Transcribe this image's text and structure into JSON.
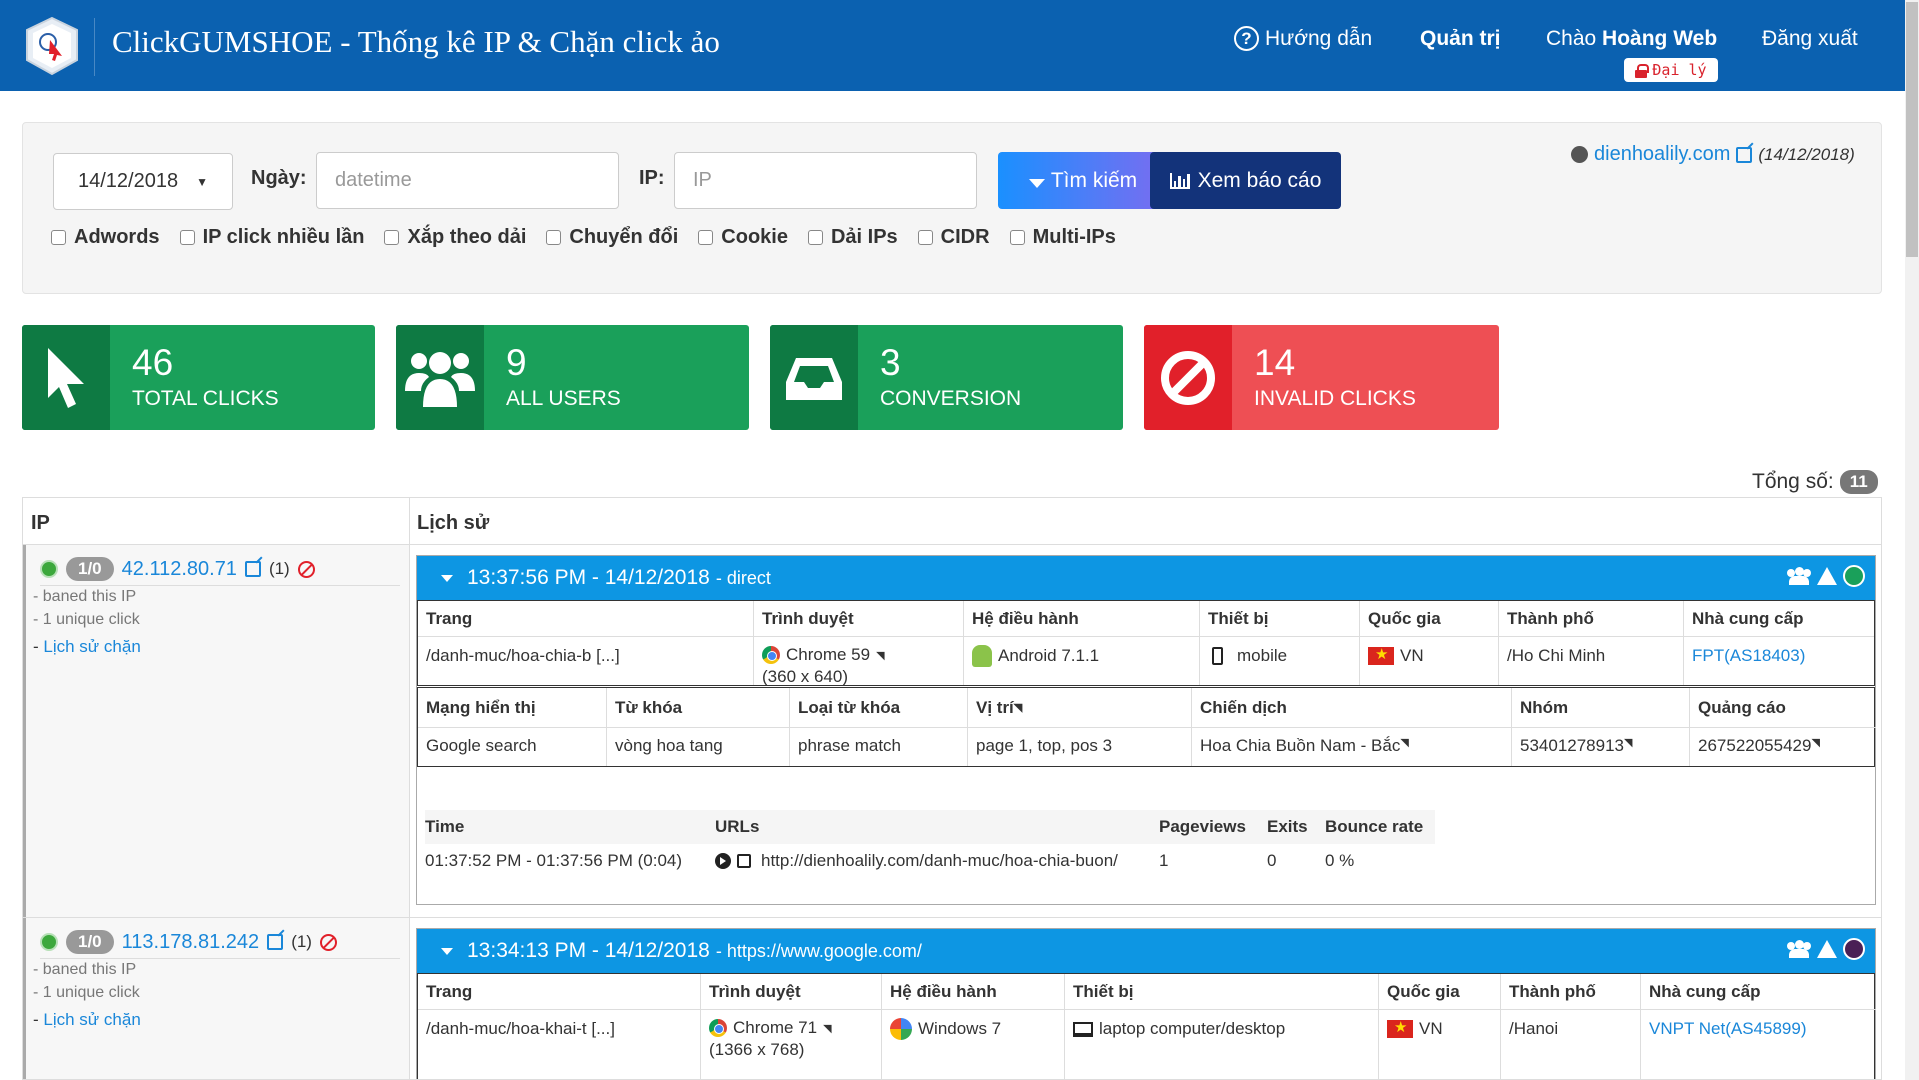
{
  "header": {
    "title": "ClickGUMSHOE - Thống kê IP & Chặn click ảo",
    "nav_help": "Hướng dẫn",
    "nav_admin": "Quản trị",
    "greet_prefix": "Chào",
    "greet_name": "Hoàng Web",
    "agent_badge": "Đại lý",
    "logout": "Đăng xuất"
  },
  "filters": {
    "date_value": "14/12/2018",
    "ngay_label": "Ngày:",
    "ngay_placeholder": "datetime",
    "ip_label": "IP:",
    "ip_placeholder": "IP",
    "search_button": "Tìm kiếm",
    "report_button": "Xem báo cáo",
    "site": "dienhoalily.com",
    "site_date": "(14/12/2018)",
    "checkboxes": [
      "Adwords",
      "IP click nhiều lần",
      "Xắp theo dải",
      "Chuyển đổi",
      "Cookie",
      "Dải IPs",
      "CIDR",
      "Multi-IPs"
    ]
  },
  "stats": [
    {
      "value": "46",
      "label": "TOTAL CLICKS",
      "icon": "cursor-icon",
      "color": "#1aa05a"
    },
    {
      "value": "9",
      "label": "ALL USERS",
      "icon": "users-icon",
      "color": "#1aa05a"
    },
    {
      "value": "3",
      "label": "CONVERSION",
      "icon": "inbox-icon",
      "color": "#1aa05a"
    },
    {
      "value": "14",
      "label": "INVALID CLICKS",
      "icon": "ban-icon",
      "color": "#ee4f54"
    }
  ],
  "total": {
    "label": "Tổng số:",
    "count": "11"
  },
  "table": {
    "col_ip": "IP",
    "col_history": "Lịch sử",
    "rows": [
      {
        "ratio": "1/0",
        "ip": "42.112.80.71",
        "ip_count": "(1)",
        "note1": "- baned this IP",
        "note2": "- 1 unique click",
        "history_prefix": "- ",
        "history_link": "Lịch sử chặn",
        "session": {
          "time": "13:37:56 PM - 14/12/2018",
          "source": "- direct",
          "status_color": "#1aa05a",
          "headers": [
            "Trang",
            "Trình duyệt",
            "Hệ điều hành",
            "Thiết bị",
            "Quốc gia",
            "Thành phố",
            "Nhà cung cấp"
          ],
          "page": "/danh-muc/hoa-chia-b [...]",
          "browser": "Chrome 59",
          "resolution": "(360 x 640)",
          "os": "Android 7.1.1",
          "device": "mobile",
          "country": "VN",
          "city": "/Ho Chi Minh",
          "isp": "FPT(AS18403)",
          "ads_headers": [
            "Mạng hiển thị",
            "Từ khóa",
            "Loại từ khóa",
            "Vị trí",
            "Chiến dịch",
            "Nhóm",
            "Quảng cáo"
          ],
          "ads": [
            "Google search",
            "vòng hoa tang",
            "phrase match",
            "page 1, top, pos 3",
            "Hoa Chia Buồn Nam - Bắc",
            "53401278913",
            "267522055429"
          ],
          "url_headers": [
            "Time",
            "URLs",
            "Pageviews",
            "Exits",
            "Bounce rate"
          ],
          "url_row": [
            "01:37:52 PM - 01:37:56 PM (0:04)",
            "http://dienhoalily.com/danh-muc/hoa-chia-buon/",
            "1",
            "0",
            "0 %"
          ]
        }
      },
      {
        "ratio": "1/0",
        "ip": "113.178.81.242",
        "ip_count": "(1)",
        "note1": "- baned this IP",
        "note2": "- 1 unique click",
        "history_prefix": "- ",
        "history_link": "Lịch sử chặn",
        "session": {
          "time": "13:34:13 PM - 14/12/2018",
          "source": "- https://www.google.com/",
          "status_color": "#4a1f55",
          "headers": [
            "Trang",
            "Trình duyệt",
            "Hệ điều hành",
            "Thiết bị",
            "Quốc gia",
            "Thành phố",
            "Nhà cung cấp"
          ],
          "page": "/danh-muc/hoa-khai-t [...]",
          "browser": "Chrome 71",
          "resolution": "(1366 x 768)",
          "os": "Windows 7",
          "device": "laptop computer/desktop",
          "country": "VN",
          "city": "/Hanoi",
          "isp": "VNPT Net(AS45899)"
        }
      }
    ]
  }
}
